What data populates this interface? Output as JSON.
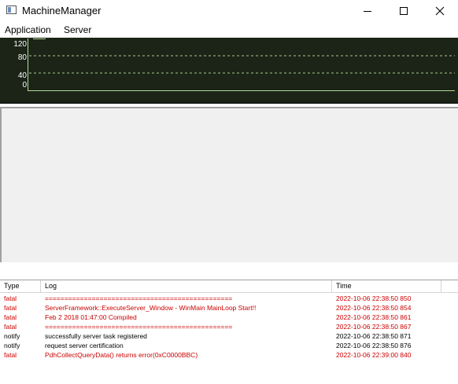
{
  "window": {
    "title": "MachineManager"
  },
  "menu": {
    "items": [
      "Application",
      "Server"
    ]
  },
  "graph": {
    "y_labels": [
      "120",
      "80",
      "40",
      "0"
    ],
    "line_color": "#b6d99a",
    "grid_color": "#a9c98a",
    "background": "#1b2417"
  },
  "log": {
    "columns": [
      "Type",
      "Log",
      "Time"
    ],
    "rows": [
      {
        "type": "fatal",
        "message": "================================================",
        "time": "2022-10-06 22:38:50 850"
      },
      {
        "type": "fatal",
        "message": "ServerFramework::ExecuteServer_Window - WinMain MainLoop Start!!",
        "time": "2022-10-06 22:38:50 854"
      },
      {
        "type": "fatal",
        "message": "Feb  2 2018 01:47:00 Compiled",
        "time": "2022-10-06 22:38:50 861"
      },
      {
        "type": "fatal",
        "message": "================================================",
        "time": "2022-10-06 22:38:50 867"
      },
      {
        "type": "notify",
        "message": "successfully server task registered",
        "time": "2022-10-06 22:38:50 871"
      },
      {
        "type": "notify",
        "message": "request server certification",
        "time": "2022-10-06 22:38:50 876"
      },
      {
        "type": "fatal",
        "message": "PdhCollectQueryData() returns error(0xC0000BBC)",
        "time": "2022-10-06 22:39:00 840"
      }
    ],
    "colors": {
      "fatal": "#cc0000",
      "notify": "#000000"
    }
  },
  "icons": {
    "minimize": "minimize-icon",
    "maximize": "maximize-icon",
    "close": "close-icon",
    "app": "app-icon"
  }
}
